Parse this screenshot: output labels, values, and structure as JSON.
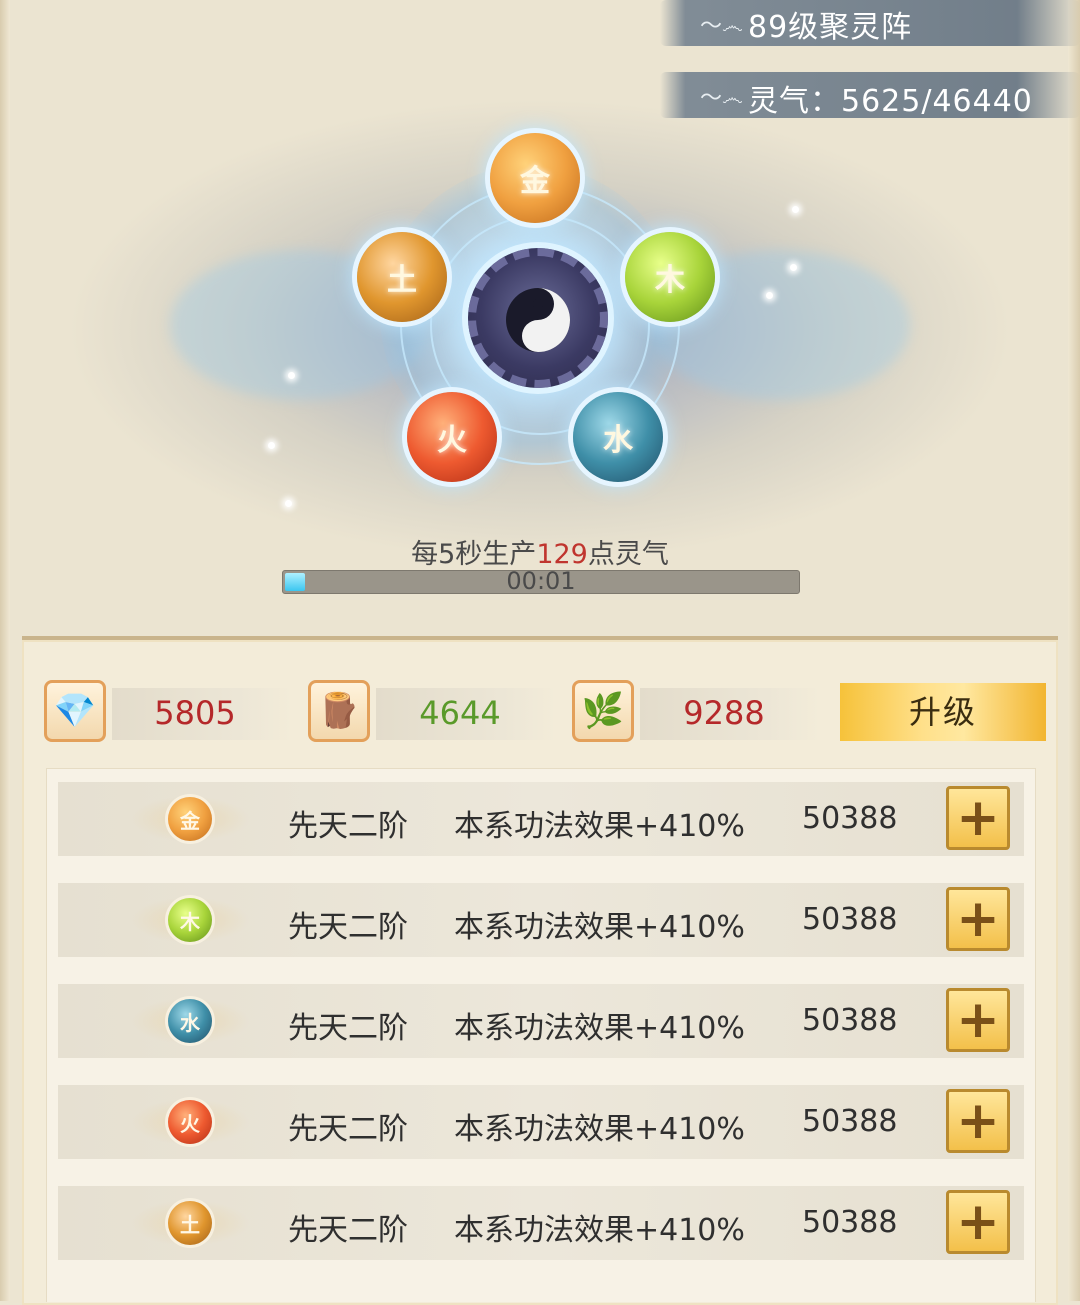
{
  "header": {
    "formation_title": "89级聚灵阵",
    "spirit_energy": "灵气：5625/46440",
    "swirl_icon": "ink-swirl-icon"
  },
  "formation": {
    "center_icon": "yinyang-icon",
    "elements": {
      "gold": "金",
      "wood": "木",
      "water": "水",
      "fire": "火",
      "earth": "土"
    },
    "production_prefix": "每5秒生产",
    "production_amount": "129",
    "production_suffix": "点灵气",
    "timer": "00:01",
    "progress": 0.04
  },
  "resources": [
    {
      "icon": "spirit-stone-icon",
      "glyph": "💎",
      "value": "5805",
      "color": "#b5282a"
    },
    {
      "icon": "wood-logs-icon",
      "glyph": "🪵",
      "value": "4644",
      "color": "#5a9a2a"
    },
    {
      "icon": "herb-icon",
      "glyph": "🌿",
      "value": "9288",
      "color": "#b5282a"
    }
  ],
  "upgrade_label": "升级",
  "rows": [
    {
      "element": "金",
      "tier": "先天二阶",
      "effect": "本系功法效果+410%",
      "cost": "50388",
      "plus": "+"
    },
    {
      "element": "木",
      "tier": "先天二阶",
      "effect": "本系功法效果+410%",
      "cost": "50388",
      "plus": "+"
    },
    {
      "element": "水",
      "tier": "先天二阶",
      "effect": "本系功法效果+410%",
      "cost": "50388",
      "plus": "+"
    },
    {
      "element": "火",
      "tier": "先天二阶",
      "effect": "本系功法效果+410%",
      "cost": "50388",
      "plus": "+"
    },
    {
      "element": "土",
      "tier": "先天二阶",
      "effect": "本系功法效果+410%",
      "cost": "50388",
      "plus": "+"
    }
  ],
  "colors": {
    "accent_red": "#c0352e",
    "accent_green": "#5a9a2a",
    "upgrade_gold": "#f6c23a",
    "progress_cyan": "#3bc6f0"
  }
}
